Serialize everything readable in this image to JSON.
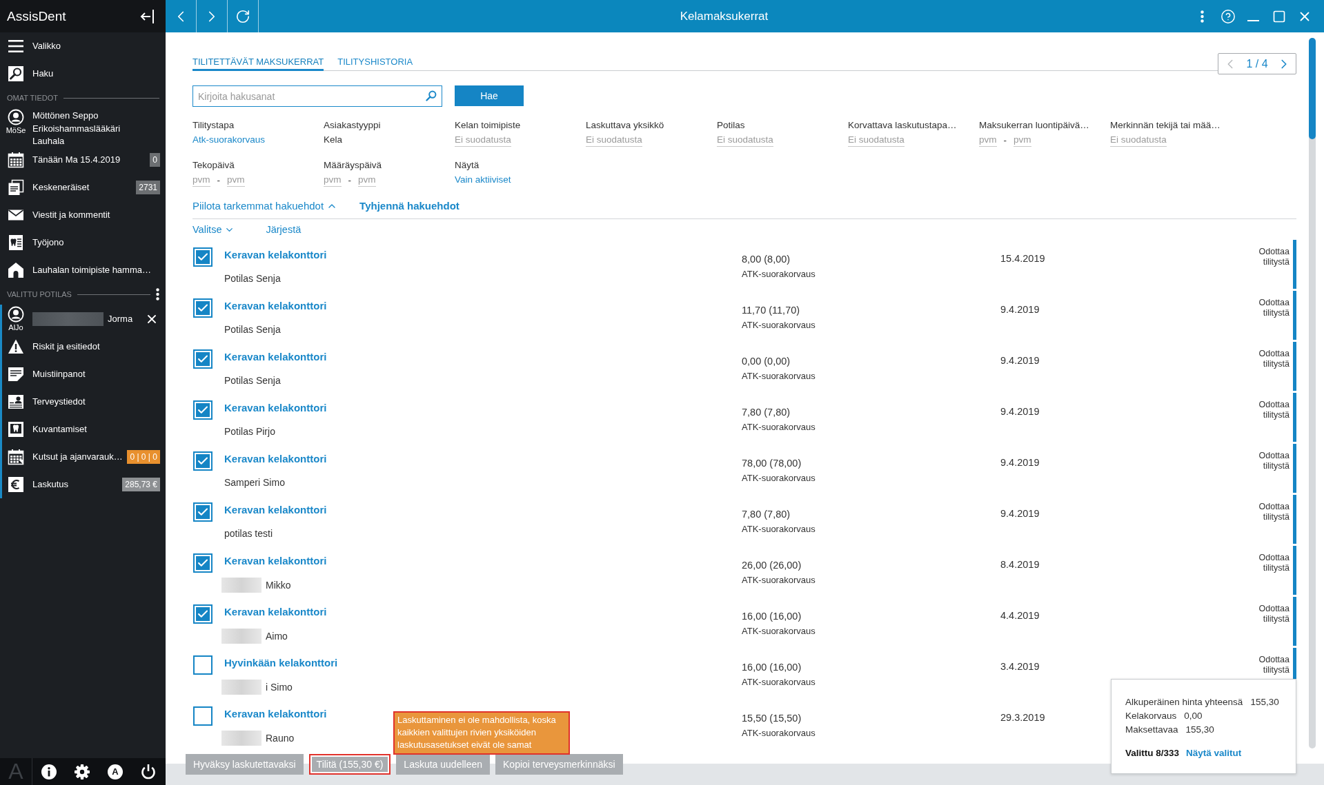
{
  "sidebar": {
    "title": "AssisDent",
    "menu": [
      {
        "label": "Valikko"
      },
      {
        "label": "Haku"
      }
    ],
    "own_info": {
      "title": "OMAT TIEDOT",
      "user": {
        "initials": "MöSe",
        "lines": [
          "Möttönen Seppo",
          "Erikoishammaslääkäri",
          "Lauhala"
        ]
      },
      "items": [
        {
          "label": "Tänään Ma 15.4.2019",
          "badge": {
            "text": "0",
            "color": "#6c6f72"
          }
        },
        {
          "label": "Keskeneräiset",
          "badge": {
            "text": "2731",
            "color": "#6c6f72"
          }
        },
        {
          "label": "Viestit ja kommentit"
        },
        {
          "label": "Työjono"
        },
        {
          "label": "Lauhalan toimipiste hamma…"
        }
      ]
    },
    "patient": {
      "title": "VALITTU POTILAS",
      "initials": "AlJo",
      "name": "Jorma",
      "redacted": true,
      "items": [
        {
          "label": "Riskit ja esitiedot"
        },
        {
          "label": "Muistiinpanot"
        },
        {
          "label": "Terveystiedot"
        },
        {
          "label": "Kuvantamiset"
        },
        {
          "label": "Kutsut ja ajanvarauk…",
          "badge": {
            "text": "0 | 0 | 0",
            "color": "#e8902e"
          }
        },
        {
          "label": "Laskutus",
          "badge": {
            "text": "285,73 €",
            "color": "#8d9093"
          }
        }
      ]
    },
    "footer": {
      "logo": "A",
      "profile_letter": "A"
    }
  },
  "topbar": {
    "title": "Kelamaksukerrat"
  },
  "page": {
    "tabs": [
      {
        "label": "TILITETTÄVÄT MAKSUKERRAT",
        "selected": true
      },
      {
        "label": "TILITYSHISTORIA",
        "selected": false
      }
    ],
    "pager": {
      "text": "1 / 4",
      "prev_disabled": true,
      "next_disabled": false
    },
    "search": {
      "placeholder": "Kirjoita hakusanat",
      "button": "Hae"
    },
    "filters": [
      {
        "label": "Tilitystapa",
        "kind": "link",
        "value": "Atk-suorakorvaus"
      },
      {
        "label": "Asiakastyyppi",
        "kind": "text",
        "value": "Kela"
      },
      {
        "label": "Kelan toimipiste",
        "kind": "unset",
        "value": "Ei suodatusta"
      },
      {
        "label": "Laskuttava yksikkö",
        "kind": "unset",
        "value": "Ei suodatusta"
      },
      {
        "label": "Potilas",
        "kind": "unset",
        "value": "Ei suodatusta"
      },
      {
        "label": "Korvattava laskutustapa…",
        "kind": "unset",
        "value": "Ei suodatusta"
      },
      {
        "label": "Maksukerran luontipäivä…",
        "kind": "range",
        "from": "pvm",
        "separator": "-",
        "to": "pvm"
      },
      {
        "label": "Merkinnän tekijä tai mää…",
        "kind": "unset",
        "value": "Ei suodatusta"
      },
      {
        "label": "Tekopäivä",
        "kind": "range",
        "from": "pvm",
        "separator": "-",
        "to": "pvm"
      },
      {
        "label": "Määräyspäivä",
        "kind": "range",
        "from": "pvm",
        "separator": "-",
        "to": "pvm"
      },
      {
        "label": "Näytä",
        "kind": "link",
        "value": "Vain aktiiviset"
      }
    ],
    "advanced_toggle": {
      "label": "Piilota tarkemmat hakuehdot",
      "expanded": true
    },
    "clear_link": "Tyhjennä hakuehdot",
    "select_menu": "Valitse",
    "sort_link": "Järjestä",
    "rows": [
      {
        "office": "Keravan kelakonttori",
        "patient": "Potilas Senja",
        "redacted": false,
        "checked": true,
        "amount": "8,00 (8,00)",
        "method": "ATK-suorakorvaus",
        "date": "15.4.2019",
        "status": "Odottaa tilitystä"
      },
      {
        "office": "Keravan kelakonttori",
        "patient": "Potilas Senja",
        "redacted": false,
        "checked": true,
        "amount": "11,70 (11,70)",
        "method": "ATK-suorakorvaus",
        "date": "9.4.2019",
        "status": "Odottaa tilitystä"
      },
      {
        "office": "Keravan kelakonttori",
        "patient": "Potilas Senja",
        "redacted": false,
        "checked": true,
        "amount": "0,00 (0,00)",
        "method": "ATK-suorakorvaus",
        "date": "9.4.2019",
        "status": "Odottaa tilitystä"
      },
      {
        "office": "Keravan kelakonttori",
        "patient": "Potilas Pirjo",
        "redacted": false,
        "checked": true,
        "amount": "7,80 (7,80)",
        "method": "ATK-suorakorvaus",
        "date": "9.4.2019",
        "status": "Odottaa tilitystä"
      },
      {
        "office": "Keravan kelakonttori",
        "patient": "Samperi Simo",
        "redacted": false,
        "checked": true,
        "amount": "78,00 (78,00)",
        "method": "ATK-suorakorvaus",
        "date": "9.4.2019",
        "status": "Odottaa tilitystä"
      },
      {
        "office": "Keravan kelakonttori",
        "patient": "potilas testi",
        "redacted": false,
        "checked": true,
        "amount": "7,80 (7,80)",
        "method": "ATK-suorakorvaus",
        "date": "9.4.2019",
        "status": "Odottaa tilitystä"
      },
      {
        "office": "Keravan kelakonttori",
        "patient": "Mikko",
        "redacted": true,
        "checked": true,
        "amount": "26,00 (26,00)",
        "method": "ATK-suorakorvaus",
        "date": "8.4.2019",
        "status": "Odottaa tilitystä"
      },
      {
        "office": "Keravan kelakonttori",
        "patient": "Aimo",
        "redacted": true,
        "checked": true,
        "amount": "16,00 (16,00)",
        "method": "ATK-suorakorvaus",
        "date": "4.4.2019",
        "status": "Odottaa tilitystä"
      },
      {
        "office": "Hyvinkään kelakonttori",
        "patient": "i Simo",
        "redacted": true,
        "checked": false,
        "amount": "16,00 (16,00)",
        "method": "ATK-suorakorvaus",
        "date": "3.4.2019",
        "status": "Odottaa tilitystä"
      },
      {
        "office": "Keravan kelakonttori",
        "patient": "Rauno",
        "redacted": true,
        "checked": false,
        "amount": "15,50 (15,50)",
        "method": "ATK-suorakorvaus",
        "date": "29.3.2019"
      }
    ],
    "actions": [
      {
        "label": "Hyväksy laskutettavaksi",
        "disabled": true,
        "highlighted": false
      },
      {
        "label": "Tilitä (155,30 €)",
        "disabled": true,
        "highlighted": true
      },
      {
        "label": "Laskuta uudelleen",
        "disabled": true,
        "highlighted": false
      },
      {
        "label": "Kopioi terveysmerkinnäksi",
        "disabled": true,
        "highlighted": false
      }
    ],
    "warning": {
      "text": "Laskuttaminen ei ole mahdollista, koska kaikkien valittujen rivien yksiköiden laskutusasetukset eivät ole samat",
      "highlighted": true
    },
    "summary": {
      "lines": [
        {
          "label": "Alkuperäinen hinta yhteensä",
          "value": "155,30"
        },
        {
          "label": "Kelakorvaus",
          "value": "0,00"
        },
        {
          "label": "Maksettavaa",
          "value": "155,30"
        }
      ],
      "selected_count": "Valittu 8/333",
      "show_selected": "Näytä valitut"
    }
  }
}
